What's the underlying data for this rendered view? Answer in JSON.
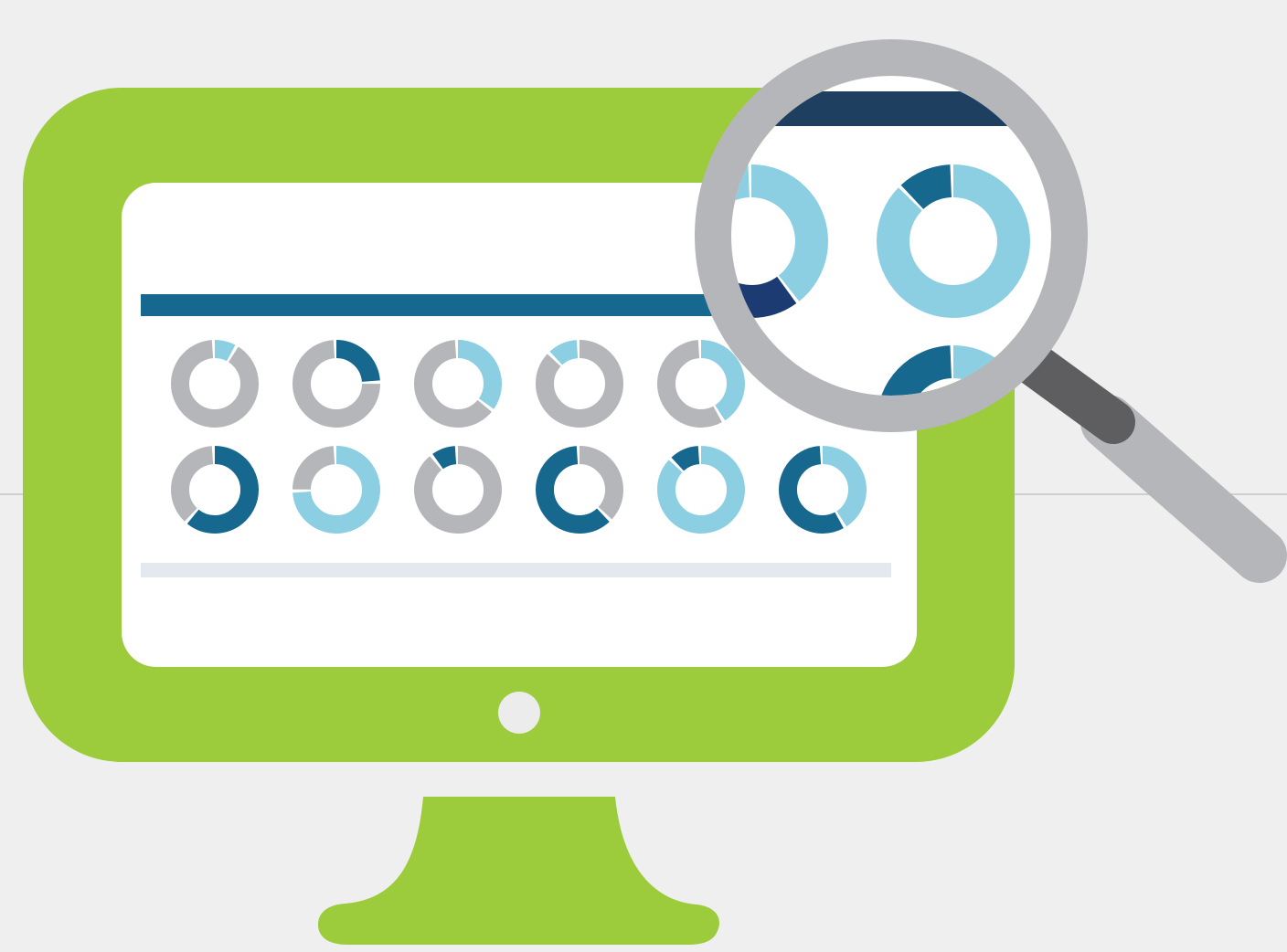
{
  "scene": {
    "subject": "computer-monitor-with-magnifying-glass",
    "colors": {
      "background": "#efefef",
      "divider_line": "#cfcfcf",
      "monitor_bezel": "#9ccb3b",
      "screen": "#ffffff",
      "header_bar": "#17688f",
      "footer_bar": "#e3e9ef",
      "power_button": "#ececec",
      "ring_gray": "#b5b6b9",
      "ring_light": "#8ccfe3",
      "ring_teal": "#17688f",
      "ring_navy": "#1c3b72",
      "lens_rim": "#b5b6b9",
      "handle_dark": "#5e5e60",
      "handle_light": "#b5b6b9",
      "zoom_header": "#1e3f5f"
    }
  },
  "donut_rows": [
    [
      {
        "segments": [
          {
            "color": "ring_light",
            "fraction": 0.09
          },
          {
            "color": "ring_gray",
            "fraction": 0.91
          }
        ]
      },
      {
        "segments": [
          {
            "color": "ring_teal",
            "fraction": 0.25
          },
          {
            "color": "ring_gray",
            "fraction": 0.75
          }
        ]
      },
      {
        "segments": [
          {
            "color": "ring_light",
            "fraction": 0.36
          },
          {
            "color": "ring_gray",
            "fraction": 0.64
          }
        ]
      },
      {
        "segments": [
          {
            "color": "ring_gray",
            "fraction": 0.88
          },
          {
            "color": "ring_light",
            "fraction": 0.12
          }
        ]
      },
      {
        "segments": [
          {
            "color": "ring_light",
            "fraction": 0.42
          },
          {
            "color": "ring_gray",
            "fraction": 0.58
          }
        ]
      }
    ],
    [
      {
        "segments": [
          {
            "color": "ring_teal",
            "fraction": 0.62
          },
          {
            "color": "ring_gray",
            "fraction": 0.38
          }
        ]
      },
      {
        "segments": [
          {
            "color": "ring_light",
            "fraction": 0.75
          },
          {
            "color": "ring_gray",
            "fraction": 0.25
          }
        ]
      },
      {
        "segments": [
          {
            "color": "ring_gray",
            "fraction": 0.9
          },
          {
            "color": "ring_teal",
            "fraction": 0.1
          }
        ]
      },
      {
        "segments": [
          {
            "color": "ring_gray",
            "fraction": 0.38
          },
          {
            "color": "ring_teal",
            "fraction": 0.62
          }
        ]
      },
      {
        "segments": [
          {
            "color": "ring_light",
            "fraction": 0.88
          },
          {
            "color": "ring_teal",
            "fraction": 0.12
          }
        ]
      },
      {
        "segments": [
          {
            "color": "ring_light",
            "fraction": 0.42
          },
          {
            "color": "ring_teal",
            "fraction": 0.58
          }
        ]
      }
    ]
  ],
  "zoomed_donuts": [
    {
      "segments": [
        {
          "color": "ring_light",
          "fraction": 0.4
        },
        {
          "color": "ring_navy",
          "fraction": 0.18
        },
        {
          "color": "ring_light",
          "fraction": 0.42
        }
      ]
    },
    {
      "segments": [
        {
          "color": "ring_light",
          "fraction": 0.88
        },
        {
          "color": "ring_teal",
          "fraction": 0.12
        }
      ]
    },
    {
      "segments": [
        {
          "color": "ring_light",
          "fraction": 0.3
        },
        {
          "color": "ring_teal",
          "fraction": 0.7
        }
      ]
    }
  ]
}
